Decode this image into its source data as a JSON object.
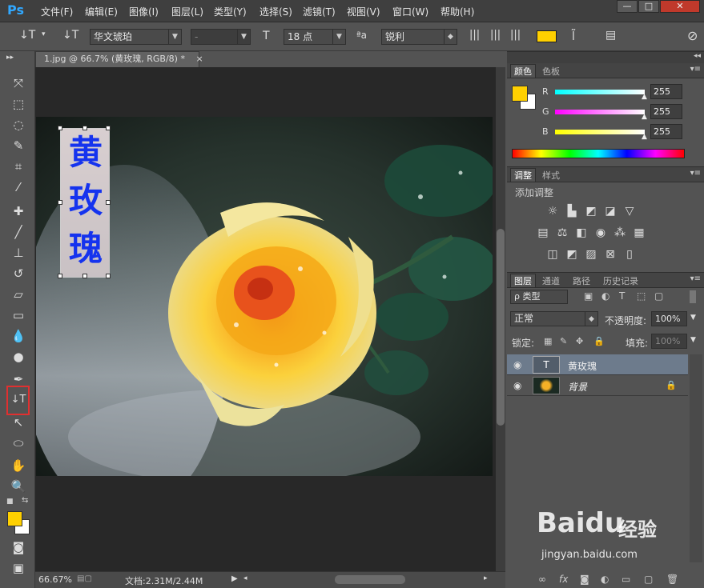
{
  "app": {
    "logo": "Ps"
  },
  "menu": [
    "文件(F)",
    "编辑(E)",
    "图像(I)",
    "图层(L)",
    "类型(Y)",
    "选择(S)",
    "滤镜(T)",
    "视图(V)",
    "窗口(W)",
    "帮助(H)"
  ],
  "window_buttons": [
    "—",
    "□",
    "✕"
  ],
  "options": {
    "font_family": "华文琥珀",
    "font_style": "-",
    "font_size": "18 点",
    "aa_label": "ªa",
    "antialias": "锐利",
    "text_color": "#ffd000"
  },
  "document": {
    "tab_title": "1.jpg @ 66.7% (黄玫瑰, RGB/8) *",
    "close": "×",
    "vertical_text": [
      "黄",
      "玫",
      "瑰"
    ]
  },
  "status": {
    "zoom": "66.67%",
    "doc_info": "文档:2.31M/2.44M"
  },
  "color_panel": {
    "tabs": [
      "颜色",
      "色板"
    ],
    "foreground": "#ffd000",
    "channels": [
      {
        "label": "R",
        "value": "255"
      },
      {
        "label": "G",
        "value": "255"
      },
      {
        "label": "B",
        "value": "255"
      }
    ]
  },
  "adjust_panel": {
    "tabs": [
      "调整",
      "样式"
    ],
    "title": "添加调整"
  },
  "layers_panel": {
    "tabs": [
      "图层",
      "通道",
      "路径",
      "历史记录"
    ],
    "filter_label": "ρ 类型",
    "blend_mode": "正常",
    "opacity_label": "不透明度:",
    "opacity": "100%",
    "lock_label": "锁定:",
    "fill_label": "填充:",
    "fill": "100%",
    "layers": [
      {
        "name": "黄玫瑰",
        "thumb": "T"
      },
      {
        "name": "背景"
      }
    ]
  },
  "watermark": {
    "brand": "Baidu",
    "suffix": "经验",
    "url": "jingyan.baidu.com"
  }
}
